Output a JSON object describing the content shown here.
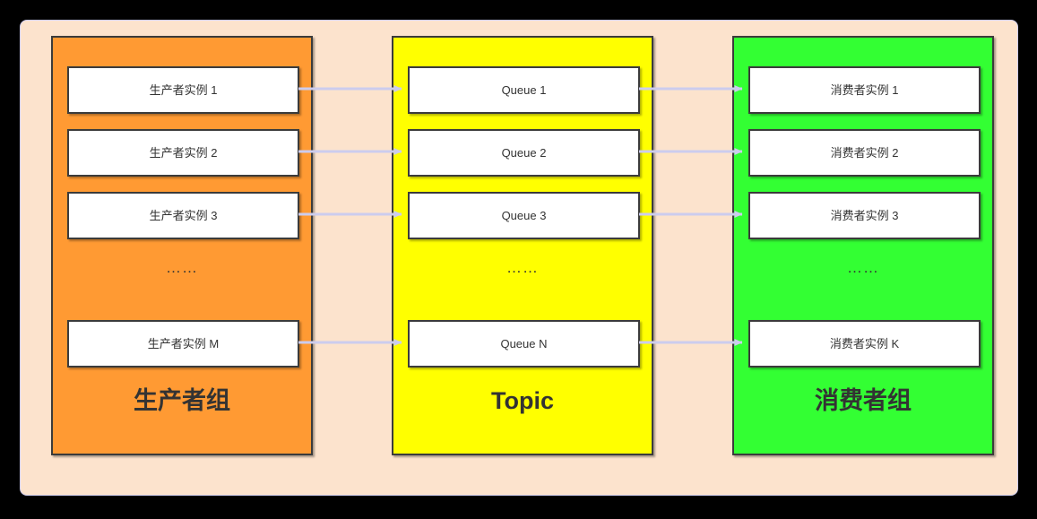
{
  "diagram": {
    "title": "Producer Group / Topic / Consumer Group messaging diagram",
    "background_color": "#000000",
    "frame_color": "#fce3cd",
    "frame_border_color": "#ccccee",
    "arrow_color": "#ccccee",
    "box_border_color": "#3b3b3b",
    "box_fill": "#ffffff",
    "ellipsis": "……"
  },
  "columns": [
    {
      "key": "producers",
      "title": "生产者组",
      "color": "#ff9a33",
      "items": [
        {
          "label": "生产者实例 1"
        },
        {
          "label": "生产者实例 2"
        },
        {
          "label": "生产者实例 3"
        },
        {
          "label": "生产者实例 M"
        }
      ],
      "ellipsis": "……"
    },
    {
      "key": "topic",
      "title": "Topic",
      "color": "#ffff00",
      "items": [
        {
          "label": "Queue 1"
        },
        {
          "label": "Queue 2"
        },
        {
          "label": "Queue 3"
        },
        {
          "label": "Queue N"
        }
      ],
      "ellipsis": "……"
    },
    {
      "key": "consumers",
      "title": "消费者组",
      "color": "#33ff33",
      "items": [
        {
          "label": "消费者实例 1"
        },
        {
          "label": "消费者实例 2"
        },
        {
          "label": "消费者实例 3"
        },
        {
          "label": "消费者实例 K"
        }
      ],
      "ellipsis": "……"
    }
  ],
  "connections": [
    {
      "from": "生产者实例 1",
      "to": "Queue 1"
    },
    {
      "from": "生产者实例 2",
      "to": "Queue 2"
    },
    {
      "from": "生产者实例 3",
      "to": "Queue 3"
    },
    {
      "from": "生产者实例 M",
      "to": "Queue N"
    },
    {
      "from": "Queue 1",
      "to": "消费者实例 1"
    },
    {
      "from": "Queue 2",
      "to": "消费者实例 2"
    },
    {
      "from": "Queue 3",
      "to": "消费者实例 3"
    },
    {
      "from": "Queue N",
      "to": "消费者实例 K"
    }
  ]
}
